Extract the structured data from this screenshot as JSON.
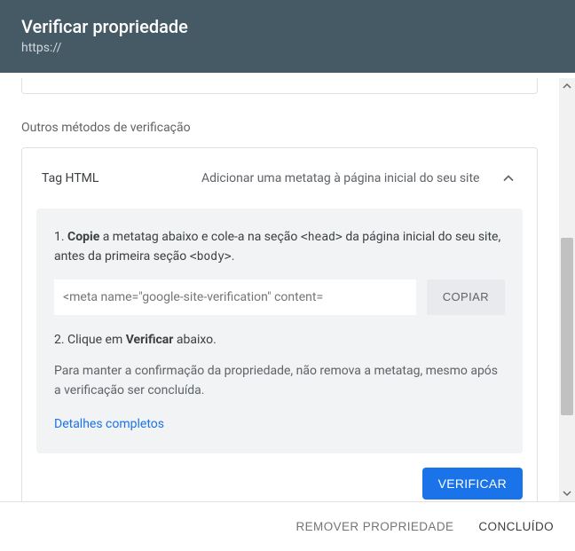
{
  "header": {
    "title": "Verificar propriedade",
    "subtitle": "https://"
  },
  "sections": {
    "other_methods_label": "Outros métodos de verificação"
  },
  "panel": {
    "title": "Tag HTML",
    "description": "Adicionar uma metatag à página inicial do seu site",
    "step1_prefix": "1. ",
    "step1_bold": "Copie",
    "step1_mid": " a metatag abaixo e cole-a na seção ",
    "step1_code1": "<head>",
    "step1_mid2": " da página inicial do seu site, antes da primeira seção ",
    "step1_code2": "<body>",
    "step1_end": ".",
    "meta_value": "<meta name=\"google-site-verification\" content=",
    "copy_label": "COPIAR",
    "step2_prefix": "2. Clique em ",
    "step2_bold": "Verificar",
    "step2_suffix": " abaixo.",
    "note": "Para manter a confirmação da propriedade, não remova a metatag, mesmo após a verificação ser concluída.",
    "details_link": "Detalhes completos",
    "verify_label": "VERIFICAR"
  },
  "footer": {
    "remove": "REMOVER PROPRIEDADE",
    "done": "CONCLUÍDO"
  }
}
